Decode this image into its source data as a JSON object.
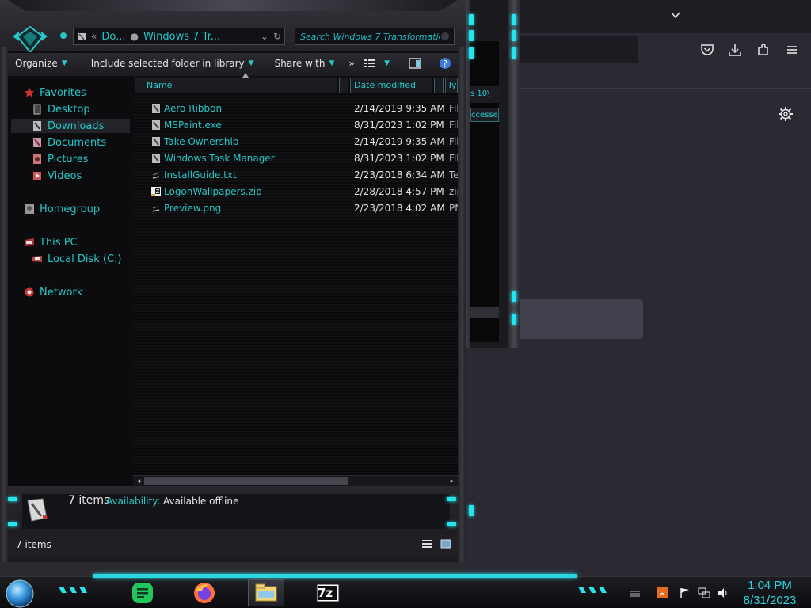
{
  "explorer": {
    "breadcrumb": [
      "Do...",
      "Windows 7 Tr..."
    ],
    "search_placeholder": "Search Windows 7 Transformatio...",
    "commands": {
      "organize": "Organize",
      "include": "Include selected folder in library",
      "share": "Share with",
      "more": "»"
    },
    "columns": {
      "name": "Name",
      "date": "Date modified",
      "type": "Ty"
    },
    "nav": {
      "favorites": "Favorites",
      "desktop": "Desktop",
      "downloads": "Downloads",
      "documents": "Documents",
      "pictures": "Pictures",
      "videos": "Videos",
      "homegroup": "Homegroup",
      "thispc": "This PC",
      "localdisk": "Local Disk (C:)",
      "network": "Network"
    },
    "files": [
      {
        "name": "Aero Ribbon",
        "date": "2/14/2019 9:35 AM",
        "type": "Fil",
        "icon": "folder-icon"
      },
      {
        "name": "MSPaint.exe",
        "date": "8/31/2023 1:02 PM",
        "type": "Fil",
        "icon": "folder-icon"
      },
      {
        "name": "Take Ownership",
        "date": "2/14/2019 9:35 AM",
        "type": "Fil",
        "icon": "folder-icon"
      },
      {
        "name": "Windows Task Manager",
        "date": "8/31/2023 1:02 PM",
        "type": "Fil",
        "icon": "folder-icon"
      },
      {
        "name": "InstallGuide.txt",
        "date": "2/23/2018 6:34 AM",
        "type": "Te",
        "icon": "text-file-icon"
      },
      {
        "name": "LogonWallpapers.zip",
        "date": "2/28/2018 4:57 PM",
        "type": "zip",
        "icon": "zip-file-icon"
      },
      {
        "name": "Preview.png",
        "date": "2/23/2018 4:02 AM",
        "type": "PN",
        "icon": "image-file-icon"
      }
    ],
    "details": {
      "count": "7 items",
      "availability_label": "Availability:",
      "availability_value": "Available offline"
    },
    "status": "7 items"
  },
  "mid_window": {
    "sort_text": "s 10\\",
    "accessed_text": "ccessed"
  },
  "taskbar": {
    "time": "1:04 PM",
    "date": "8/31/2023",
    "apps": [
      "notes-app-icon",
      "firefox-icon",
      "file-explorer-icon",
      "7zip-icon"
    ],
    "sevenzip_label": "7z"
  },
  "colors": {
    "accent_cyan": "#25c7c7",
    "led_cyan": "#24e4ee",
    "browser_bg": "#2b2a33"
  }
}
